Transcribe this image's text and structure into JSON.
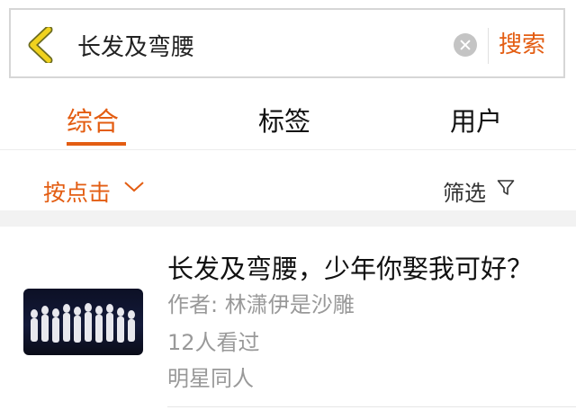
{
  "search": {
    "query": "长发及弯腰",
    "search_label": "搜索"
  },
  "tabs": [
    {
      "label": "综合",
      "active": true
    },
    {
      "label": "标签",
      "active": false
    },
    {
      "label": "用户",
      "active": false
    }
  ],
  "filters": {
    "sort_label": "按点击",
    "filter_label": "筛选"
  },
  "results": [
    {
      "title": "长发及弯腰，少年你娶我可好？",
      "author": "作者: 林潇伊是沙雕",
      "views": "12人看过",
      "category": "明星同人"
    }
  ],
  "colors": {
    "accent": "#e35d12",
    "back_icon": "#f0d21e"
  },
  "icons": {
    "back": "chevron-left-icon",
    "clear": "clear-icon",
    "sort": "chevron-down-icon",
    "filter": "funnel-icon"
  }
}
